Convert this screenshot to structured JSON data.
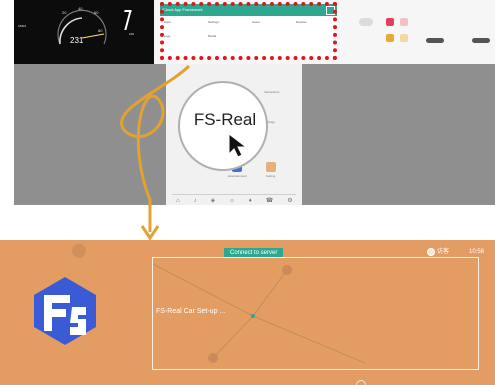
{
  "top": {
    "dash": {
      "brand": "CM04",
      "speed": "231",
      "gauge_hi": "100",
      "tick_a": "20",
      "tick_b": "40",
      "tick_c": "60",
      "tick_d": "80"
    },
    "cloud": {
      "title": "iCloud App Framework",
      "labels": [
        "Apps",
        "Settings",
        "Users",
        "Devices",
        "Logs",
        "Model"
      ]
    },
    "center": {
      "zoom_text": "FS-Real",
      "left_label": "Instructions",
      "right_label": "Settings"
    },
    "app_labels": [
      "Entertainment",
      "Setting"
    ]
  },
  "app": {
    "status": "Connect to server",
    "user": "访客",
    "time": "10:58",
    "car_label": "FS-Real Car Set-up ..."
  },
  "colors": {
    "accent": "#2ea790",
    "app_bg": "#e39d62",
    "highlight": "#e0161c",
    "arrow": "#e3a033"
  }
}
